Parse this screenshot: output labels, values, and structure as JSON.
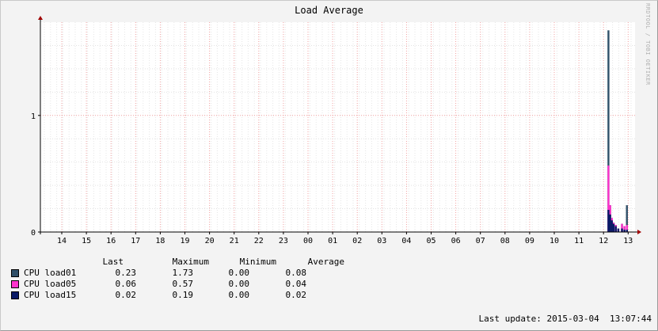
{
  "chart_data": {
    "type": "area",
    "title": "Load Average",
    "watermark": "RRDTOOL / TOBI OETIKER",
    "ylim": [
      0,
      1.8
    ],
    "y_ticks": [
      0,
      1
    ],
    "x_ticks": [
      "14",
      "15",
      "16",
      "17",
      "18",
      "19",
      "20",
      "21",
      "22",
      "23",
      "00",
      "01",
      "02",
      "03",
      "04",
      "05",
      "06",
      "07",
      "08",
      "09",
      "10",
      "11",
      "12",
      "13"
    ],
    "series": [
      {
        "name": "CPU load01",
        "color": "#2f4f68"
      },
      {
        "name": "CPU load05",
        "color": "#ff33cc"
      },
      {
        "name": "CPU load15",
        "color": "#0b1a66"
      }
    ],
    "x_hours": [
      12.2,
      12.27,
      12.34,
      12.41,
      12.5,
      12.6,
      12.75,
      12.85,
      12.95
    ],
    "load01": [
      1.73,
      0.23,
      0.12,
      0.08,
      0.06,
      0.03,
      0.07,
      0.05,
      0.23
    ],
    "load05": [
      0.57,
      0.23,
      0.12,
      0.08,
      0.06,
      0.03,
      0.07,
      0.05,
      0.06
    ],
    "load15": [
      0.19,
      0.15,
      0.1,
      0.07,
      0.05,
      0.03,
      0.03,
      0.02,
      0.02
    ]
  },
  "legend": {
    "headers": [
      "Last",
      "Maximum",
      "Minimum",
      "Average"
    ],
    "rows": [
      {
        "label": "CPU load01",
        "color": "#2f4f68",
        "last": "0.23",
        "max": "1.73",
        "min": "0.00",
        "avg": "0.08"
      },
      {
        "label": "CPU load05",
        "color": "#ff33cc",
        "last": "0.06",
        "max": "0.57",
        "min": "0.00",
        "avg": "0.04"
      },
      {
        "label": "CPU load15",
        "color": "#0b1a66",
        "last": "0.02",
        "max": "0.19",
        "min": "0.00",
        "avg": "0.02"
      }
    ]
  },
  "footer": {
    "last_update": "Last update: 2015-03-04  13:07:44"
  }
}
